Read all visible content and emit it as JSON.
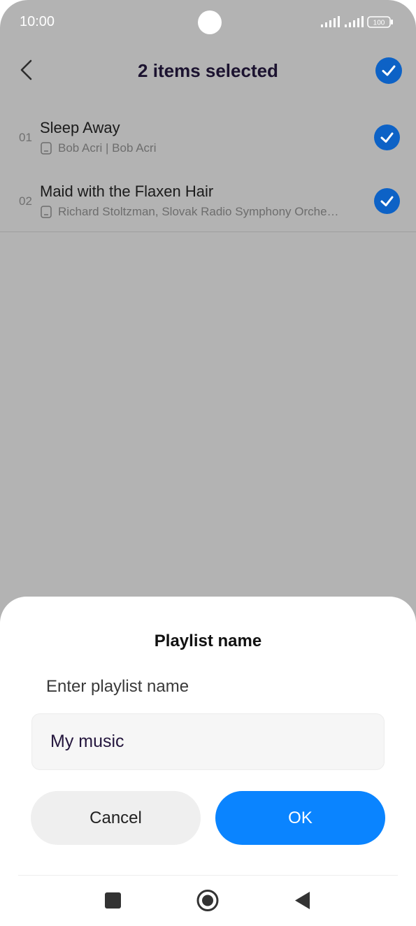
{
  "status_bar": {
    "time": "10:00",
    "battery": "100"
  },
  "header": {
    "title": "2 items selected"
  },
  "songs": [
    {
      "number": "01",
      "title": "Sleep Away",
      "subtitle": "Bob Acri | Bob Acri",
      "selected": true
    },
    {
      "number": "02",
      "title": "Maid with the Flaxen Hair",
      "subtitle": "Richard Stoltzman, Slovak Radio Symphony Orche…",
      "selected": true
    }
  ],
  "dialog": {
    "title": "Playlist name",
    "label": "Enter playlist name",
    "input_value": "My music",
    "cancel_label": "Cancel",
    "ok_label": "OK"
  },
  "icons": {
    "back": "chevron-left-icon",
    "select_all": "check-circle-icon",
    "item_check": "check-circle-icon",
    "device": "phone-storage-icon",
    "nav_recents": "square-icon",
    "nav_home": "circle-icon",
    "nav_back": "triangle-back-icon"
  },
  "colors": {
    "overlay": "#b3b3b3",
    "check": "#0d62c6",
    "ok_button": "#0a84ff",
    "cancel_button": "#efefef"
  }
}
